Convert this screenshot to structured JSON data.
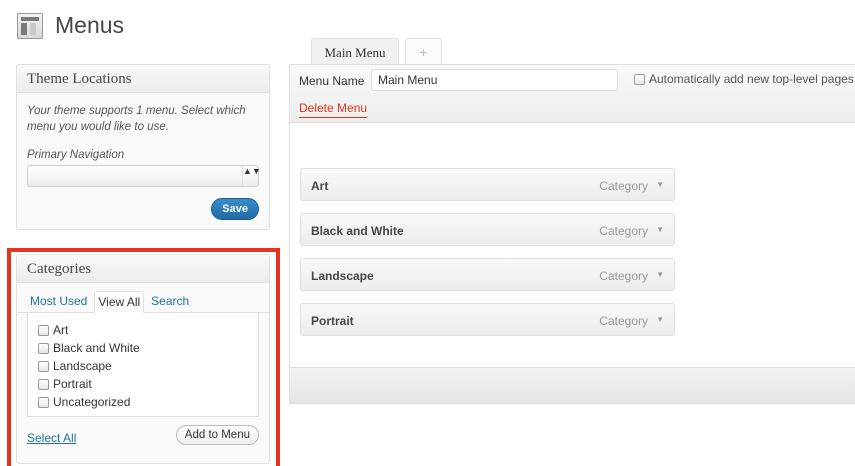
{
  "header": {
    "title": "Menus",
    "icon": "menus-icon"
  },
  "theme_locations": {
    "title": "Theme Locations",
    "description": "Your theme supports 1 menu. Select which menu you would like to use.",
    "primary_label": "Primary Navigation",
    "select_value": "",
    "select_arrows": "▲▼",
    "save_label": "Save"
  },
  "categories": {
    "title": "Categories",
    "tabs": [
      {
        "label": "Most Used",
        "active": false
      },
      {
        "label": "View All",
        "active": true
      },
      {
        "label": "Search",
        "active": false
      }
    ],
    "items": [
      {
        "label": "Art",
        "checked": false
      },
      {
        "label": "Black and White",
        "checked": false
      },
      {
        "label": "Landscape",
        "checked": false
      },
      {
        "label": "Portrait",
        "checked": false
      },
      {
        "label": "Uncategorized",
        "checked": false
      }
    ],
    "select_all_label": "Select All",
    "add_label": "Add to Menu"
  },
  "menu_tabs": {
    "active_label": "Main Menu",
    "add_label": "+"
  },
  "menu_editor": {
    "name_label": "Menu Name",
    "name_value": "Main Menu",
    "auto_add_label": "Automatically add new top-level pages",
    "auto_add_checked": false,
    "delete_label": "Delete Menu",
    "items": [
      {
        "title": "Art",
        "type": "Category"
      },
      {
        "title": "Black and White",
        "type": "Category"
      },
      {
        "title": "Landscape",
        "type": "Category"
      },
      {
        "title": "Portrait",
        "type": "Category"
      }
    ],
    "item_arrow": "▼"
  },
  "colors": {
    "accent_link": "#21759b",
    "highlight_frame": "#e5341e",
    "save_button": "#2a7ab9",
    "delete_link": "#e5341e"
  }
}
